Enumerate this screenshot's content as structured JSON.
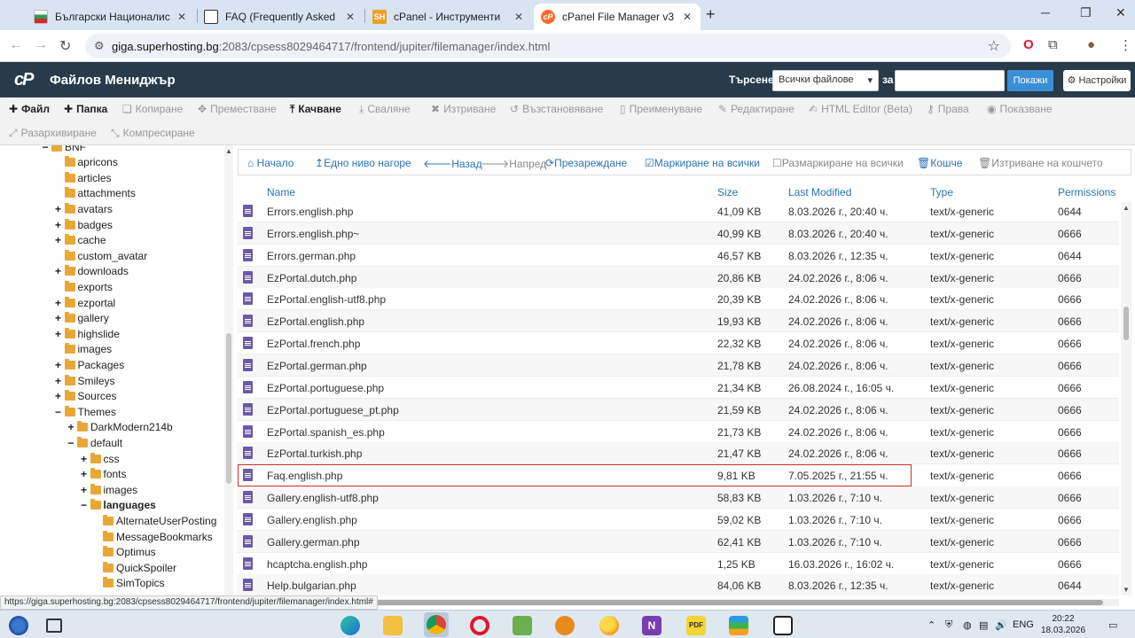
{
  "browser": {
    "tabs": [
      {
        "title": "Български Националистическ",
        "active": false
      },
      {
        "title": "FAQ (Frequently Asked Questio",
        "active": false
      },
      {
        "title": "cPanel - Инструменти",
        "active": false
      },
      {
        "title": "cPanel File Manager v3",
        "active": true
      }
    ],
    "url_host": "giga.superhosting.bg",
    "url_path": ":2083/cpsess8029464717/frontend/jupiter/filemanager/index.html"
  },
  "header": {
    "title": "Файлов Мениджър",
    "search_label": "Търсене",
    "search_scope": "Всички файлове",
    "for_label": "за",
    "search_value": "",
    "show_button": "Покажи",
    "settings_button": "Настройки"
  },
  "toolbar": {
    "file": "Файл",
    "folder": "Папка",
    "copy": "Копиране",
    "move": "Преместване",
    "upload": "Качване",
    "download": "Сваляне",
    "delete": "Изтриване",
    "restore": "Възстановяване",
    "rename": "Преименуване",
    "edit": "Редактиране",
    "html_editor": "HTML Editor (Beta)",
    "permissions": "Права",
    "view": "Показване",
    "extract": "Разархивиране",
    "compress": "Компресиране"
  },
  "nav": {
    "home": "Начало",
    "up": "Едно ниво нагоре",
    "back": "Назад",
    "forward": "Напред",
    "reload": "Презареждане",
    "select_all": "Маркиране на всички",
    "unselect_all": "Размаркиране на всички",
    "trash": "Кошче",
    "empty_trash": "Изтриване на кошчето"
  },
  "tree": [
    {
      "label": "BNF",
      "depth": 0,
      "toggle": "−",
      "bold": false
    },
    {
      "label": "apricons",
      "depth": 1,
      "toggle": "",
      "bold": false
    },
    {
      "label": "articles",
      "depth": 1,
      "toggle": "",
      "bold": false
    },
    {
      "label": "attachments",
      "depth": 1,
      "toggle": "",
      "bold": false
    },
    {
      "label": "avatars",
      "depth": 1,
      "toggle": "+",
      "bold": false
    },
    {
      "label": "badges",
      "depth": 1,
      "toggle": "+",
      "bold": false
    },
    {
      "label": "cache",
      "depth": 1,
      "toggle": "+",
      "bold": false
    },
    {
      "label": "custom_avatar",
      "depth": 1,
      "toggle": "",
      "bold": false
    },
    {
      "label": "downloads",
      "depth": 1,
      "toggle": "+",
      "bold": false
    },
    {
      "label": "exports",
      "depth": 1,
      "toggle": "",
      "bold": false
    },
    {
      "label": "ezportal",
      "depth": 1,
      "toggle": "+",
      "bold": false
    },
    {
      "label": "gallery",
      "depth": 1,
      "toggle": "+",
      "bold": false
    },
    {
      "label": "highslide",
      "depth": 1,
      "toggle": "+",
      "bold": false
    },
    {
      "label": "images",
      "depth": 1,
      "toggle": "",
      "bold": false
    },
    {
      "label": "Packages",
      "depth": 1,
      "toggle": "+",
      "bold": false
    },
    {
      "label": "Smileys",
      "depth": 1,
      "toggle": "+",
      "bold": false
    },
    {
      "label": "Sources",
      "depth": 1,
      "toggle": "+",
      "bold": false
    },
    {
      "label": "Themes",
      "depth": 1,
      "toggle": "−",
      "bold": false
    },
    {
      "label": "DarkModern214b",
      "depth": 2,
      "toggle": "+",
      "bold": false
    },
    {
      "label": "default",
      "depth": 2,
      "toggle": "−",
      "bold": false
    },
    {
      "label": "css",
      "depth": 3,
      "toggle": "+",
      "bold": false
    },
    {
      "label": "fonts",
      "depth": 3,
      "toggle": "+",
      "bold": false
    },
    {
      "label": "images",
      "depth": 3,
      "toggle": "+",
      "bold": false
    },
    {
      "label": "languages",
      "depth": 3,
      "toggle": "−",
      "bold": true
    },
    {
      "label": "AlternateUserPosting",
      "depth": 4,
      "toggle": "",
      "bold": false
    },
    {
      "label": "MessageBookmarks",
      "depth": 4,
      "toggle": "",
      "bold": false
    },
    {
      "label": "Optimus",
      "depth": 4,
      "toggle": "",
      "bold": false
    },
    {
      "label": "QuickSpoiler",
      "depth": 4,
      "toggle": "",
      "bold": false
    },
    {
      "label": "SimTopics",
      "depth": 4,
      "toggle": "",
      "bold": false
    }
  ],
  "table": {
    "columns": {
      "name": "Name",
      "size": "Size",
      "modified": "Last Modified",
      "type": "Type",
      "perms": "Permissions"
    },
    "rows": [
      {
        "name": "Errors.english.php",
        "size": "41,09 KB",
        "modified": "8.03.2026 г., 20:40 ч.",
        "type": "text/x-generic",
        "perms": "0644"
      },
      {
        "name": "Errors.english.php~",
        "size": "40,99 KB",
        "modified": "8.03.2026 г., 20:40 ч.",
        "type": "text/x-generic",
        "perms": "0666"
      },
      {
        "name": "Errors.german.php",
        "size": "46,57 KB",
        "modified": "8.03.2026 г., 12:35 ч.",
        "type": "text/x-generic",
        "perms": "0644"
      },
      {
        "name": "EzPortal.dutch.php",
        "size": "20,86 KB",
        "modified": "24.02.2026 г., 8:06 ч.",
        "type": "text/x-generic",
        "perms": "0666"
      },
      {
        "name": "EzPortal.english-utf8.php",
        "size": "20,39 KB",
        "modified": "24.02.2026 г., 8:06 ч.",
        "type": "text/x-generic",
        "perms": "0666"
      },
      {
        "name": "EzPortal.english.php",
        "size": "19,93 KB",
        "modified": "24.02.2026 г., 8:06 ч.",
        "type": "text/x-generic",
        "perms": "0666"
      },
      {
        "name": "EzPortal.french.php",
        "size": "22,32 KB",
        "modified": "24.02.2026 г., 8:06 ч.",
        "type": "text/x-generic",
        "perms": "0666"
      },
      {
        "name": "EzPortal.german.php",
        "size": "21,78 KB",
        "modified": "24.02.2026 г., 8:06 ч.",
        "type": "text/x-generic",
        "perms": "0666"
      },
      {
        "name": "EzPortal.portuguese.php",
        "size": "21,34 KB",
        "modified": "26.08.2024 г., 16:05 ч.",
        "type": "text/x-generic",
        "perms": "0666"
      },
      {
        "name": "EzPortal.portuguese_pt.php",
        "size": "21,59 KB",
        "modified": "24.02.2026 г., 8:06 ч.",
        "type": "text/x-generic",
        "perms": "0666"
      },
      {
        "name": "EzPortal.spanish_es.php",
        "size": "21,73 KB",
        "modified": "24.02.2026 г., 8:06 ч.",
        "type": "text/x-generic",
        "perms": "0666"
      },
      {
        "name": "EzPortal.turkish.php",
        "size": "21,47 KB",
        "modified": "24.02.2026 г., 8:06 ч.",
        "type": "text/x-generic",
        "perms": "0666"
      },
      {
        "name": "Faq.english.php",
        "size": "9,81 KB",
        "modified": "7.05.2025 г., 21:55 ч.",
        "type": "text/x-generic",
        "perms": "0666",
        "selected": true
      },
      {
        "name": "Gallery.english-utf8.php",
        "size": "58,83 KB",
        "modified": "1.03.2026 г., 7:10 ч.",
        "type": "text/x-generic",
        "perms": "0666"
      },
      {
        "name": "Gallery.english.php",
        "size": "59,02 KB",
        "modified": "1.03.2026 г., 7:10 ч.",
        "type": "text/x-generic",
        "perms": "0666"
      },
      {
        "name": "Gallery.german.php",
        "size": "62,41 KB",
        "modified": "1.03.2026 г., 7:10 ч.",
        "type": "text/x-generic",
        "perms": "0666"
      },
      {
        "name": "hcaptcha.english.php",
        "size": "1,25 KB",
        "modified": "16.03.2026 г., 16:02 ч.",
        "type": "text/x-generic",
        "perms": "0666"
      },
      {
        "name": "Help.bulgarian.php",
        "size": "84,06 KB",
        "modified": "8.03.2026 г., 12:35 ч.",
        "type": "text/x-generic",
        "perms": "0644"
      }
    ]
  },
  "statusbar": {
    "url": "https://giga.superhosting.bg:2083/cpsess8029464717/frontend/jupiter/filemanager/index.html#"
  },
  "taskbar": {
    "lang": "ENG",
    "time": "20:22",
    "date": "18.03.2026 г."
  },
  "colors": {
    "header_bg": "#293a4a",
    "link": "#2a73b8",
    "selected_outline": "#c9302c",
    "folder": "#e8a838",
    "file_icon": "#6b5aa8"
  }
}
